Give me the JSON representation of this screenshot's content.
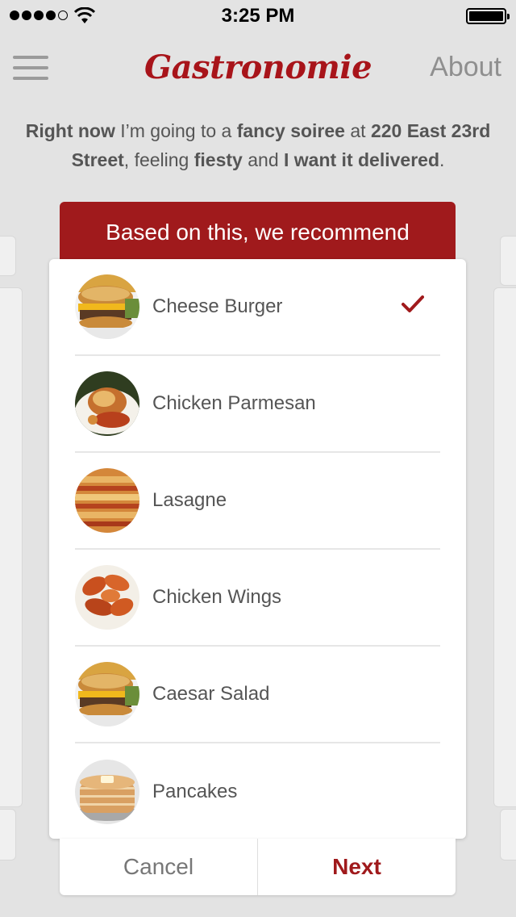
{
  "status_bar": {
    "time": "3:25 PM"
  },
  "nav": {
    "title": "Gastronomie",
    "about_label": "About"
  },
  "sentence": {
    "p1": "Right now",
    "p2": " I’m going to a ",
    "p3": "fancy soiree",
    "p4": " at ",
    "p5": "220 East 23rd Street",
    "p6": ", feeling ",
    "p7": "fiesty",
    "p8": " and ",
    "p9": "I want it delivered",
    "p10": "."
  },
  "recommend": {
    "header": "Based on this, we recommend",
    "items": [
      {
        "label": "Cheese Burger",
        "icon": "cheese-burger-photo",
        "selected": true
      },
      {
        "label": "Chicken Parmesan",
        "icon": "chicken-parmesan-photo",
        "selected": false
      },
      {
        "label": "Lasagne",
        "icon": "lasagne-photo",
        "selected": false
      },
      {
        "label": "Chicken Wings",
        "icon": "chicken-wings-photo",
        "selected": false
      },
      {
        "label": "Caesar Salad",
        "icon": "caesar-salad-photo",
        "selected": false
      },
      {
        "label": "Pancakes",
        "icon": "pancakes-photo",
        "selected": false
      }
    ]
  },
  "footer": {
    "cancel_label": "Cancel",
    "next_label": "Next"
  },
  "colors": {
    "accent": "#a01a1c",
    "background": "#e3e3e3"
  }
}
